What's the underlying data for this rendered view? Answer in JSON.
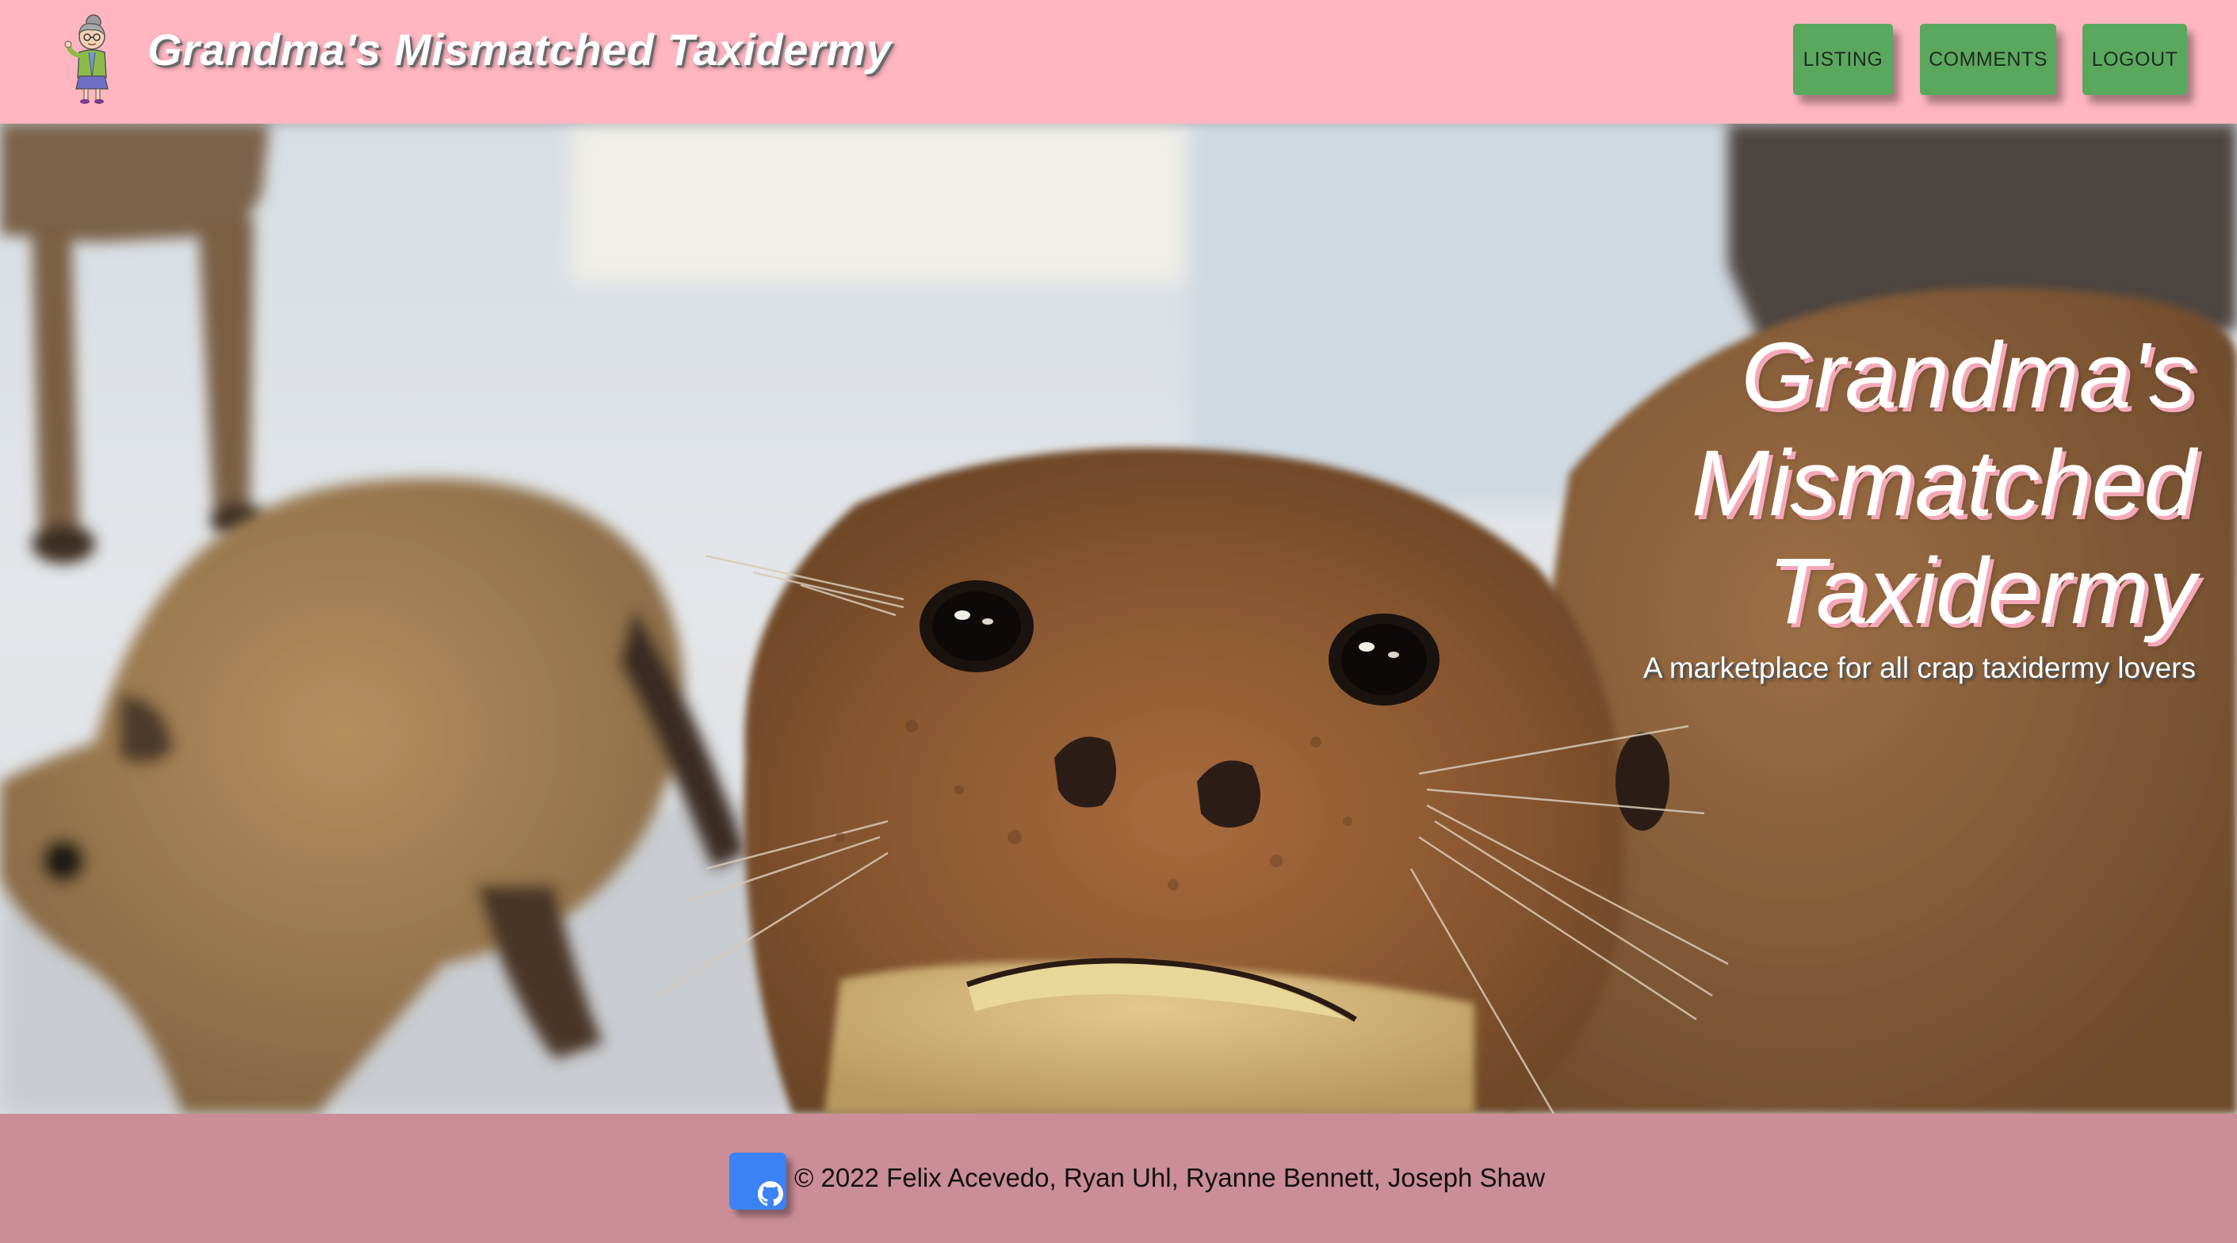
{
  "header": {
    "brand_title": "Grandma's Mismatched Taxidermy",
    "logo_icon": "grandma-icon",
    "nav": {
      "listing_label": "LISTING",
      "comments_label": "COMMENTS",
      "logout_label": "LOGOUT"
    }
  },
  "hero": {
    "title_line1": "Grandma's",
    "title_line2": "Mismatched",
    "title_line3": "Taxidermy",
    "subtitle": "A marketplace for all crap taxidermy lovers"
  },
  "footer": {
    "github_icon": "github-icon",
    "copyright": "© 2022 Felix Acevedo, Ryan Uhl, Ryanne Bennett, Joseph Shaw"
  },
  "colors": {
    "header_bg": "#ffb6c1",
    "nav_button_bg": "#5aa85e",
    "footer_bg": "#cb8d97",
    "github_button_bg": "#3b82f6",
    "hero_title_shadow": "#f4a8b8"
  }
}
